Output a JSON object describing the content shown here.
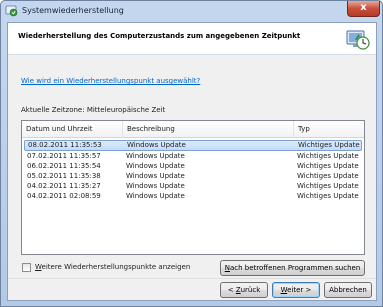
{
  "window": {
    "title": "Systemwiederherstellung",
    "close_label": "x"
  },
  "header": {
    "title": "Wiederherstellung des Computerzustands zum angegebenen Zeitpunkt"
  },
  "help_link": "Wie wird ein Wiederherstellungspunkt ausgewählt?",
  "timezone_label": "Aktuelle Zeitzone: Mitteleuropäische Zeit",
  "table": {
    "columns": [
      "Datum und Uhrzeit",
      "Beschreibung",
      "Typ"
    ],
    "rows": [
      {
        "date": "08.02.2011 11:35:53",
        "description": "Windows Update",
        "type": "Wichtiges Update",
        "selected": true
      },
      {
        "date": "07.02.2011 11:35:57",
        "description": "Windows Update",
        "type": "Wichtiges Update"
      },
      {
        "date": "06.02.2011 11:35:54",
        "description": "Windows Update",
        "type": "Wichtiges Update"
      },
      {
        "date": "05.02.2011 11:35:38",
        "description": "Windows Update",
        "type": "Wichtiges Update"
      },
      {
        "date": "04.02.2011 11:35:27",
        "description": "Windows Update",
        "type": "Wichtiges Update"
      },
      {
        "date": "04.02.2011 02:08:59",
        "description": "Windows Update",
        "type": "Wichtiges Update"
      }
    ]
  },
  "more_points": {
    "label_first": "W",
    "label_rest": "eitere Wiederherstellungspunkte anzeigen",
    "checked": false
  },
  "buttons": {
    "scan_first": "N",
    "scan_rest": "ach betroffenen Programmen suchen",
    "back_prefix": "< ",
    "back_access": "Z",
    "back_rest": "urück",
    "next_access": "W",
    "next_rest": "eiter >",
    "cancel": "Abbrechen"
  },
  "colors": {
    "link": "#0066cc",
    "selection": "#c1dbfc",
    "close_button": "#c7503b"
  },
  "icons": [
    "system-restore-icon",
    "restore-clock-icon",
    "close-icon"
  ]
}
